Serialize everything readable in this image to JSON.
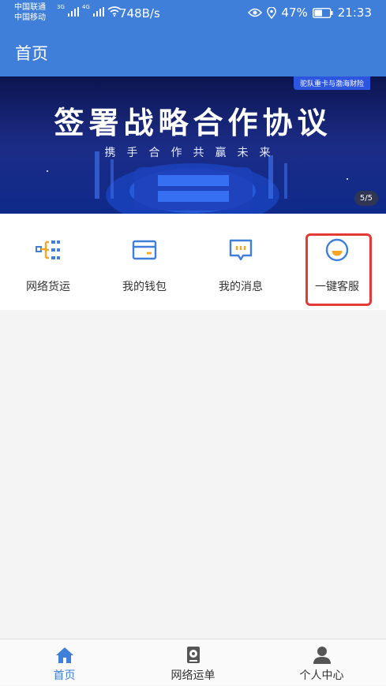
{
  "status_bar": {
    "carrier1": "中国联通",
    "carrier2": "中国移动",
    "net1": "3G",
    "net2": "4G",
    "speed": "748B/s",
    "battery": "47%",
    "time": "21:33"
  },
  "header": {
    "title": "首页"
  },
  "banner": {
    "tag": "驼队重卡与渤海财险",
    "title": "签署战略合作协议",
    "subtitle": "携手合作共赢未来",
    "page": "5/5"
  },
  "features": [
    {
      "label": "网络货运",
      "icon": "network-freight-icon"
    },
    {
      "label": "我的钱包",
      "icon": "wallet-icon"
    },
    {
      "label": "我的消息",
      "icon": "message-icon"
    },
    {
      "label": "一键客服",
      "icon": "customer-service-icon"
    }
  ],
  "bottom_nav": [
    {
      "label": "首页",
      "icon": "home-icon"
    },
    {
      "label": "网络运单",
      "icon": "waybill-icon"
    },
    {
      "label": "个人中心",
      "icon": "profile-icon"
    }
  ],
  "colors": {
    "primary": "#3f7fd9",
    "accent": "#f5a623",
    "highlight": "#e53935"
  }
}
